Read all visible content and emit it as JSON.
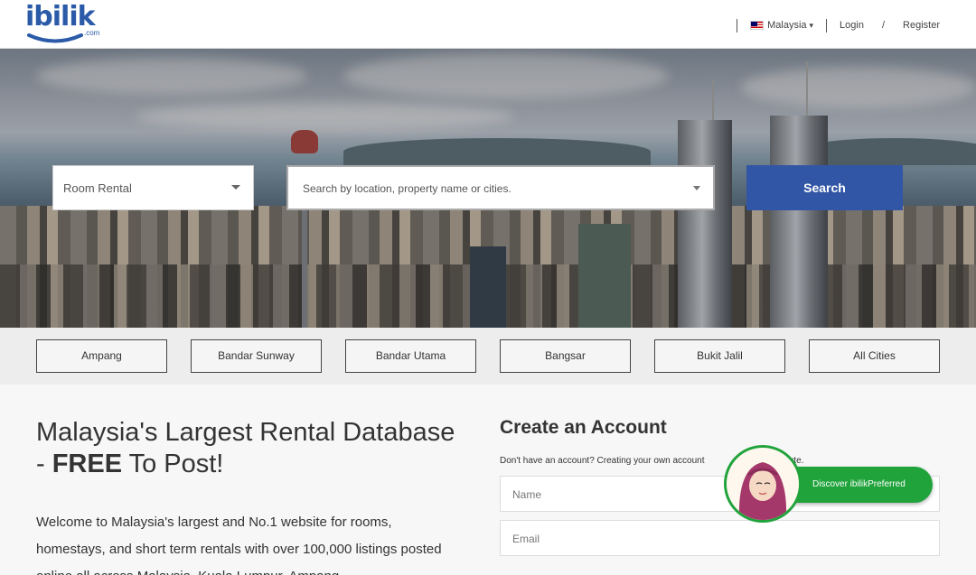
{
  "header": {
    "logo_text": "ibilik",
    "logo_suffix": ".com",
    "country": "Malaysia",
    "login": "Login",
    "slash": "/",
    "register": "Register"
  },
  "search": {
    "type_value": "Room Rental",
    "placeholder": "Search by location, property name or cities.",
    "button": "Search"
  },
  "cities": [
    "Ampang",
    "Bandar Sunway",
    "Bandar Utama",
    "Bangsar",
    "Bukit Jalil",
    "All Cities"
  ],
  "main": {
    "heading_line1": "Malaysia's Largest Rental Database",
    "heading_dash": "- ",
    "heading_free": "FREE",
    "heading_rest": " To Post!",
    "intro": "Welcome to Malaysia's largest and No.1 website for rooms, homestays, and short term rentals with over 100,000 listings posted online all across Malaysia, Kuala Lumpur, Ampang"
  },
  "account": {
    "title": "Create an Account",
    "subtitle": "Don't have an account? Creating your own account",
    "subtitle_end": "a minute.",
    "name_placeholder": "Name",
    "email_placeholder": "Email"
  },
  "badge": {
    "label": "Discover ibilikPreferred"
  },
  "colors": {
    "brand": "#2b5ba8",
    "search_button": "#3256a6",
    "badge_green": "#21a33c"
  }
}
